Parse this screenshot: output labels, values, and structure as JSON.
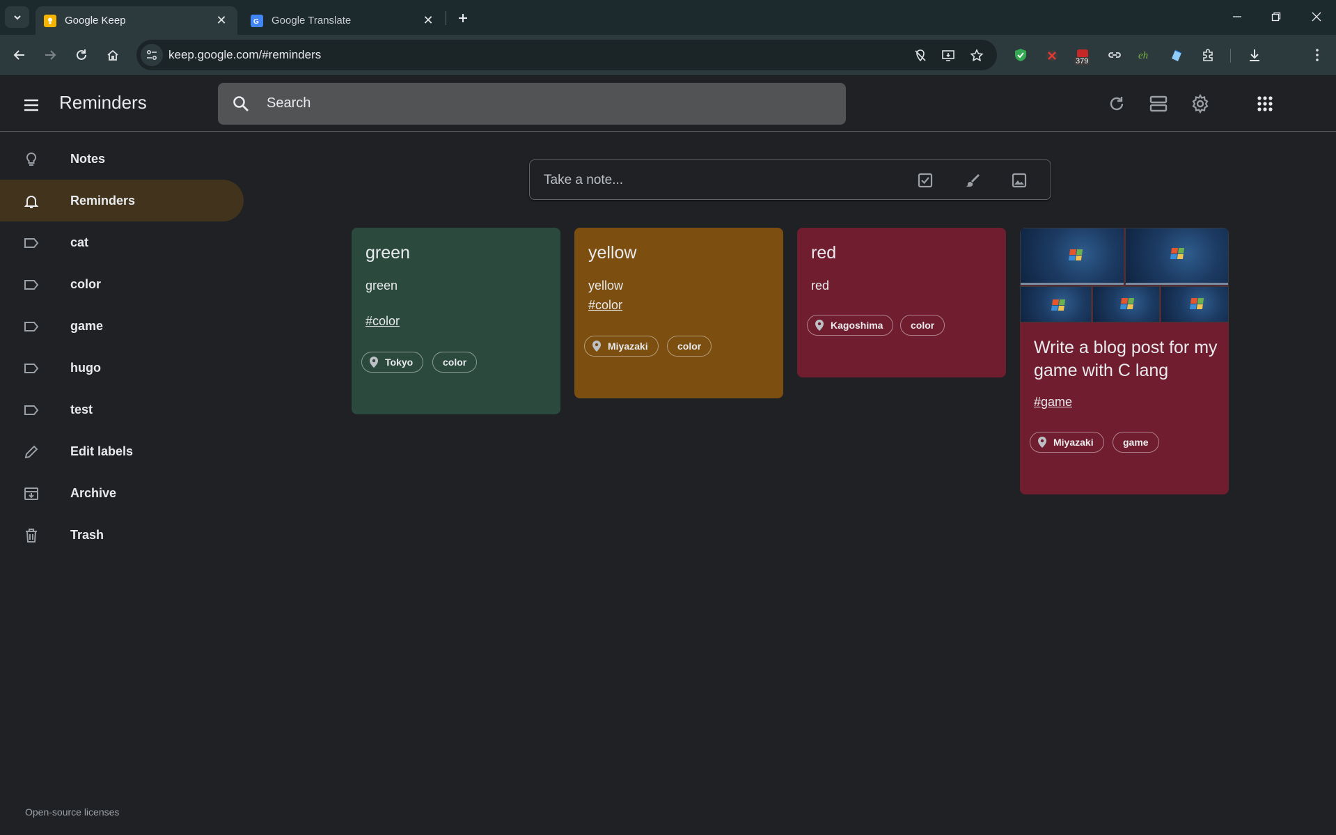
{
  "browser": {
    "tabs": [
      {
        "title": "Google Keep",
        "active": true
      },
      {
        "title": "Google Translate",
        "active": false
      }
    ],
    "url": "keep.google.com/#reminders",
    "extension_badge": "379"
  },
  "header": {
    "title": "Reminders",
    "search_placeholder": "Search"
  },
  "sidebar": {
    "items": [
      {
        "label": "Notes",
        "icon": "lightbulb-icon"
      },
      {
        "label": "Reminders",
        "icon": "bell-icon",
        "active": true
      },
      {
        "label": "cat",
        "icon": "label-icon"
      },
      {
        "label": "color",
        "icon": "label-icon"
      },
      {
        "label": "game",
        "icon": "label-icon"
      },
      {
        "label": "hugo",
        "icon": "label-icon"
      },
      {
        "label": "test",
        "icon": "label-icon"
      },
      {
        "label": "Edit labels",
        "icon": "pencil-icon"
      },
      {
        "label": "Archive",
        "icon": "archive-icon"
      },
      {
        "label": "Trash",
        "icon": "trash-icon"
      }
    ],
    "footer": "Open-source licenses"
  },
  "composer": {
    "placeholder": "Take a note..."
  },
  "notes": [
    {
      "title": "green",
      "body": "green",
      "hashtag": "#color",
      "location": "Tokyo",
      "label": "color",
      "color": "#2b4a3d"
    },
    {
      "title": "yellow",
      "body": "yellow",
      "hashtag": "#color",
      "location": "Miyazaki",
      "label": "color",
      "color": "#7c4e0f"
    },
    {
      "title": "red",
      "body": "red",
      "location": "Kagoshima",
      "label": "color",
      "color": "#701e2f"
    },
    {
      "title": "Write a blog post for my game with C lang",
      "hashtag": "#game",
      "location": "Miyazaki",
      "label": "game",
      "color": "#701e2f",
      "images": 5
    }
  ]
}
